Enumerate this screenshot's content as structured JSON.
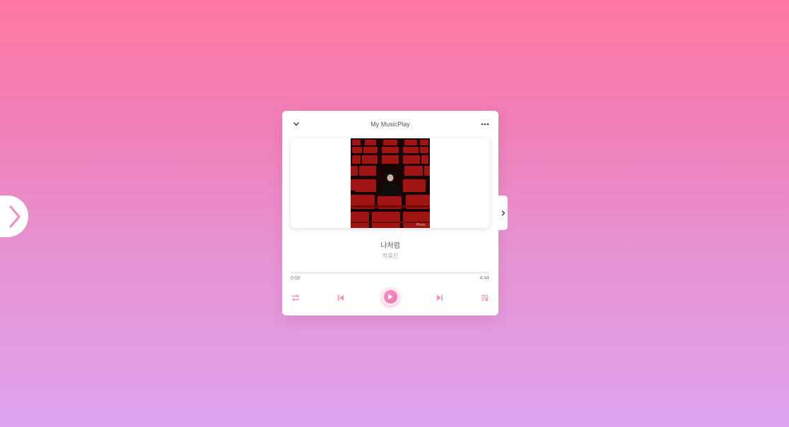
{
  "player": {
    "title": "My MusicPlay",
    "song": {
      "title": "나처럼",
      "artist": "박효신"
    },
    "album_watermark": "Photo",
    "progress": {
      "current": "0:00",
      "duration": "4:44",
      "fraction": 0
    }
  },
  "icons": {
    "side_toggle": "chevron-right-icon",
    "collapse": "chevron-down-icon",
    "menu": "more-horizontal-icon",
    "playlist_toggle": "chevron-right-icon",
    "repeat": "repeat-icon",
    "previous": "skip-previous-icon",
    "play": "play-icon",
    "next": "skip-next-icon",
    "playlist": "playlist-icon"
  },
  "colors": {
    "accent": "#f27fb5",
    "background_top": "#fe77a1",
    "background_bottom": "#dda3ee",
    "text": "#555555",
    "subtext": "#a0a0a0"
  }
}
